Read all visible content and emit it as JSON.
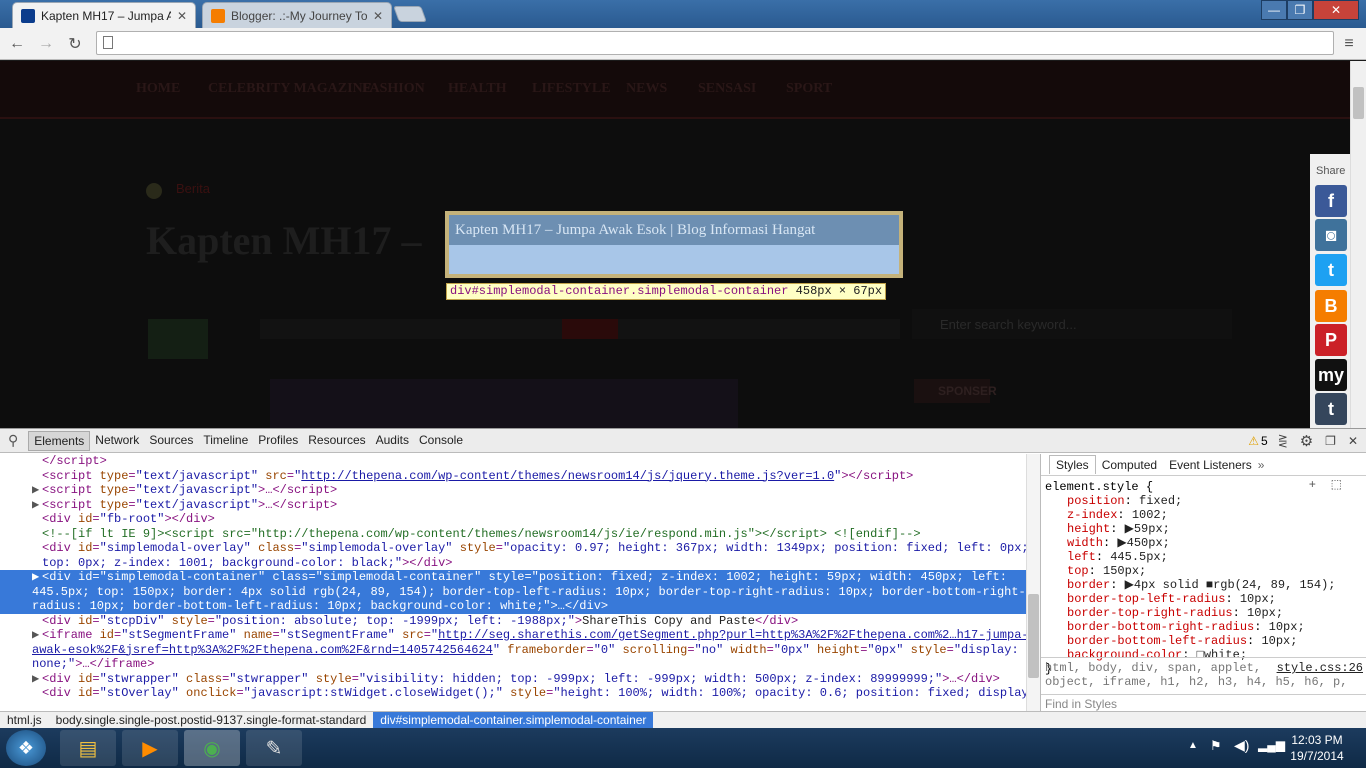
{
  "browser": {
    "tabs": [
      {
        "title": "Kapten MH17 – Jumpa Aw",
        "close": "✕",
        "active": true
      },
      {
        "title": "Blogger: .:-My Journey To",
        "close": "✕",
        "active": false
      }
    ],
    "window_controls": {
      "minimize": "—",
      "maximize": "❐",
      "close": "✕"
    },
    "omnibox_value": ""
  },
  "page": {
    "nav_items": [
      "HOME",
      "CELEBRITY MAGAZINE",
      "FASHION",
      "HEALTH",
      "LIFESTYLE",
      "NEWS",
      "SENSASI",
      "SPORT"
    ],
    "article_title_partial": "Kapten MH17 –",
    "breadcrumb_fragment": "Berita",
    "search_placeholder": "Enter search keyword...",
    "sponsor_label": "SPONSER",
    "share_label": "Share"
  },
  "share_icons": [
    {
      "name": "facebook-icon",
      "glyph": "f",
      "color": "#3b5998"
    },
    {
      "name": "instagram-icon",
      "glyph": "◙",
      "color": "#3f729b"
    },
    {
      "name": "twitter-icon",
      "glyph": "t",
      "color": "#1da1f2"
    },
    {
      "name": "blogger-icon",
      "glyph": "B",
      "color": "#f57d00"
    },
    {
      "name": "pinterest-icon",
      "glyph": "P",
      "color": "#cb2027"
    },
    {
      "name": "myspace-icon",
      "glyph": "my",
      "color": "#111111"
    },
    {
      "name": "tumblr-icon",
      "glyph": "t",
      "color": "#35465c"
    }
  ],
  "modal": {
    "title": "Kapten MH17 – Jumpa Awak Esok | Blog Informasi Hangat",
    "tooltip_selector": "div#simplemodal-container.simplemodal-container",
    "tooltip_size": "458px × 67px"
  },
  "devtools": {
    "tabs": [
      "Elements",
      "Network",
      "Sources",
      "Timeline",
      "Profiles",
      "Resources",
      "Audits",
      "Console"
    ],
    "active_tab": "Elements",
    "warning_count": "5",
    "styles_tabs": [
      "Styles",
      "Computed",
      "Event Listeners"
    ],
    "element_style_header": "element.style {",
    "element_style_close": "}",
    "style_props": [
      {
        "name": "position",
        "value": "fixed;"
      },
      {
        "name": "z-index",
        "value": "1002;"
      },
      {
        "name": "height",
        "value": "▶59px;"
      },
      {
        "name": "width",
        "value": "▶450px;"
      },
      {
        "name": "left",
        "value": "445.5px;"
      },
      {
        "name": "top",
        "value": "150px;"
      },
      {
        "name": "border",
        "value": "▶4px solid ■rgb(24, 89, 154);"
      },
      {
        "name": "border-top-left-radius",
        "value": "10px;"
      },
      {
        "name": "border-top-right-radius",
        "value": "10px;"
      },
      {
        "name": "border-bottom-right-radius",
        "value": "10px;"
      },
      {
        "name": "border-bottom-left-radius",
        "value": "10px;"
      },
      {
        "name": "background-color",
        "value": "□white;"
      }
    ],
    "inherited_selectors": "html, body, div, span, applet,",
    "inherited_selectors2": "object, iframe, h1, h2, h3, h4, h5, h6, p,",
    "stylesheet_link": "style.css:26",
    "find_in_styles": "Find in Styles",
    "code_lines": [
      {
        "tri": "",
        "html": "&lt;/script&gt;"
      },
      {
        "tri": "",
        "html": "&lt;script <span class='at'>type</span>=<span class='av'>\"text/javascript\"</span> <span class='at'>src</span>=<span class='av'>\"</span><span class='lk'>http://thepena.com/wp-content/themes/newsroom14/js/jquery.theme.js?ver=1.0</span><span class='av'>\"</span>&gt;&lt;/script&gt;"
      },
      {
        "tri": "▶",
        "html": "&lt;script <span class='at'>type</span>=<span class='av'>\"text/javascript\"</span>&gt;…&lt;/script&gt;"
      },
      {
        "tri": "▶",
        "html": "&lt;script <span class='at'>type</span>=<span class='av'>\"text/javascript\"</span>&gt;…&lt;/script&gt;"
      },
      {
        "tri": "",
        "html": "&lt;div <span class='at'>id</span>=<span class='av'>\"fb-root\"</span>&gt;&lt;/div&gt;"
      },
      {
        "tri": "",
        "html": "<span class='cm'>&lt;!--[if lt IE 9]&gt;&lt;script src=\"http://thepena.com/wp-content/themes/newsroom14/js/ie/respond.min.js\"&gt;&lt;/script&gt; &lt;![endif]--&gt;</span>"
      },
      {
        "tri": "",
        "html": "&lt;div <span class='at'>id</span>=<span class='av'>\"simplemodal-overlay\"</span> <span class='at'>class</span>=<span class='av'>\"simplemodal-overlay\"</span> <span class='at'>style</span>=<span class='av'>\"opacity: 0.97; height: 367px; width: 1349px; position: fixed; left: 0px;</span>"
      },
      {
        "tri": "",
        "html": "<span class='av'>top: 0px; z-index: 1001; background-color: black;\"</span>&gt;&lt;/div&gt;"
      },
      {
        "tri": "▶",
        "sel": true,
        "html": "&lt;div id=\"simplemodal-container\" class=\"simplemodal-container\" style=\"position: fixed; z-index: 1002; height: 59px; width: 450px; left:"
      },
      {
        "tri": "",
        "sel": true,
        "indent": true,
        "html": "445.5px; top: 150px; border: 4px solid rgb(24, 89, 154); border-top-left-radius: 10px; border-top-right-radius: 10px; border-bottom-right-"
      },
      {
        "tri": "",
        "sel": true,
        "indent": true,
        "html": "radius: 10px; border-bottom-left-radius: 10px; background-color: white;\"&gt;…&lt;/div&gt;"
      },
      {
        "tri": "",
        "html": "&lt;div <span class='at'>id</span>=<span class='av'>\"stcpDiv\"</span> <span class='at'>style</span>=<span class='av'>\"position: absolute; top: -1999px; left: -1988px;\"</span>&gt;<span class='tx'>ShareThis Copy and Paste</span>&lt;/div&gt;"
      },
      {
        "tri": "▶",
        "html": "&lt;iframe <span class='at'>id</span>=<span class='av'>\"stSegmentFrame\"</span> <span class='at'>name</span>=<span class='av'>\"stSegmentFrame\"</span> <span class='at'>src</span>=<span class='av'>\"</span><span class='lk'>http://seg.sharethis.com/getSegment.php?purl=http%3A%2F%2Fthepena.com%2…h17-jumpa-</span>"
      },
      {
        "tri": "",
        "indent": true,
        "html": "<span class='lk'>awak-esok%2F&amp;jsref=http%3A%2F%2Fthepena.com%2F&amp;rnd=1405742564624</span><span class='av'>\"</span> <span class='at'>frameborder</span>=<span class='av'>\"0\"</span> <span class='at'>scrolling</span>=<span class='av'>\"no\"</span> <span class='at'>width</span>=<span class='av'>\"0px\"</span> <span class='at'>height</span>=<span class='av'>\"0px\"</span> <span class='at'>style</span>=<span class='av'>\"display:</span>"
      },
      {
        "tri": "",
        "indent": true,
        "html": "<span class='av'>none;\"</span>&gt;…&lt;/iframe&gt;"
      },
      {
        "tri": "▶",
        "html": "&lt;div <span class='at'>id</span>=<span class='av'>\"stwrapper\"</span> <span class='at'>class</span>=<span class='av'>\"stwrapper\"</span> <span class='at'>style</span>=<span class='av'>\"visibility: hidden; top: -999px; left: -999px; width: 500px; z-index: 89999999;\"</span>&gt;…&lt;/div&gt;"
      },
      {
        "tri": "",
        "html": "&lt;div <span class='at'>id</span>=<span class='av'>\"stOverlay\"</span> <span class='at'>onclick</span>=<span class='av'>\"javascript:stWidget.closeWidget();\"</span> <span class='at'>style</span>=<span class='av'>\"height: 100%; width: 100%; opacity: 0.6; position: fixed; display:</span>"
      }
    ],
    "breadcrumbs": [
      "html.js",
      "body.single.single-post.postid-9137.single-format-standard",
      "div#simplemodal-container.simplemodal-container"
    ]
  },
  "taskbar": {
    "time": "12:03 PM",
    "date": "19/7/2014"
  }
}
